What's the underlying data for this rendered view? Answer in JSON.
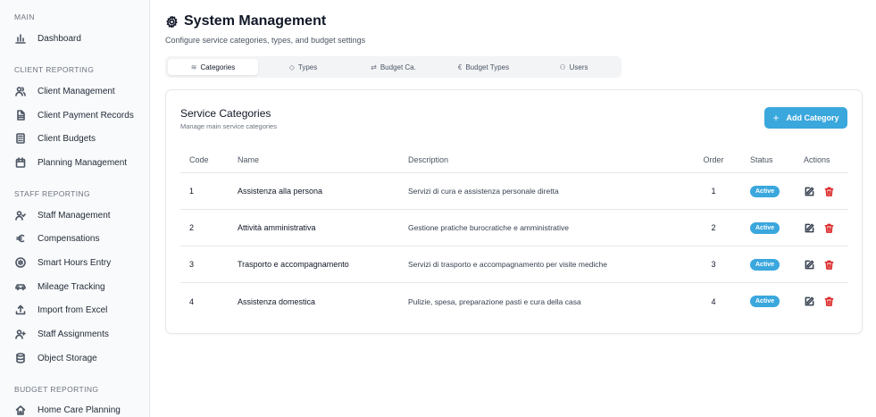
{
  "sidebar": {
    "sections": [
      {
        "label": "MAIN",
        "items": [
          {
            "label": "Dashboard",
            "icon": "bar-chart-icon"
          }
        ]
      },
      {
        "label": "CLIENT REPORTING",
        "items": [
          {
            "label": "Client Management",
            "icon": "users-icon"
          },
          {
            "label": "Client Payment Records",
            "icon": "file-text-icon"
          },
          {
            "label": "Client Budgets",
            "icon": "calculator-icon"
          },
          {
            "label": "Planning Management",
            "icon": "calendar-icon"
          }
        ]
      },
      {
        "label": "STAFF REPORTING",
        "items": [
          {
            "label": "Staff Management",
            "icon": "user-check-icon"
          },
          {
            "label": "Compensations",
            "icon": "euro-icon"
          },
          {
            "label": "Smart Hours Entry",
            "icon": "fingerprint-icon"
          },
          {
            "label": "Mileage Tracking",
            "icon": "car-icon"
          },
          {
            "label": "Import from Excel",
            "icon": "upload-icon"
          },
          {
            "label": "Staff Assignments",
            "icon": "user-plus-icon"
          },
          {
            "label": "Object Storage",
            "icon": "database-icon"
          }
        ]
      },
      {
        "label": "BUDGET REPORTING",
        "items": [
          {
            "label": "Home Care Planning",
            "icon": "home-icon"
          }
        ]
      }
    ]
  },
  "header": {
    "title": "System Management",
    "subtitle": "Configure service categories, types, and budget settings"
  },
  "tabs": [
    {
      "label": "Categories",
      "icon": "layers-icon",
      "active": true
    },
    {
      "label": "Types",
      "icon": "tag-icon",
      "active": false
    },
    {
      "label": "Budget Ca.",
      "icon": "budget-icon",
      "active": false
    },
    {
      "label": "Budget Types",
      "icon": "euro-icon",
      "active": false
    },
    {
      "label": "Users",
      "icon": "users-icon",
      "active": false
    }
  ],
  "card": {
    "title": "Service Categories",
    "subtitle": "Manage main service categories",
    "add_button": "Add Category"
  },
  "table": {
    "columns": [
      "Code",
      "Name",
      "Description",
      "Order",
      "Status",
      "Actions"
    ],
    "rows": [
      {
        "code": "1",
        "name": "Assistenza alla persona",
        "description": "Servizi di cura e assistenza personale diretta",
        "order": "1",
        "status": "Active"
      },
      {
        "code": "2",
        "name": "Attività amministrativa",
        "description": "Gestione pratiche burocratiche e amministrative",
        "order": "2",
        "status": "Active"
      },
      {
        "code": "3",
        "name": "Trasporto e accompagnamento",
        "description": "Servizi di trasporto e accompagnamento per visite mediche",
        "order": "3",
        "status": "Active"
      },
      {
        "code": "4",
        "name": "Assistenza domestica",
        "description": "Pulizie, spesa, preparazione pasti e cura della casa",
        "order": "4",
        "status": "Active"
      }
    ]
  },
  "colors": {
    "accent": "#3aa7dd",
    "danger": "#dc2626"
  }
}
